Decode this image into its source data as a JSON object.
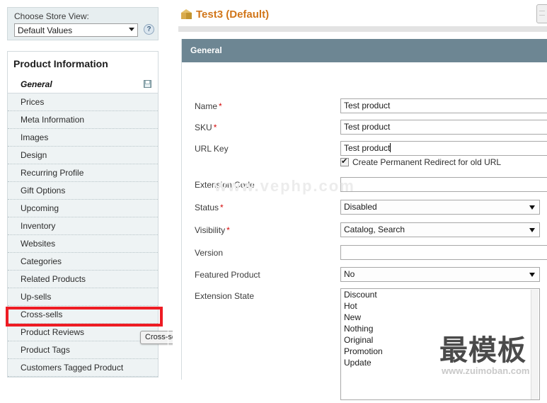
{
  "sidebar": {
    "store_view": {
      "label": "Choose Store View:",
      "selected": "Default Values",
      "help_glyph": "?"
    },
    "section_title": "Product Information",
    "general_tab": "General",
    "items": [
      {
        "label": "Prices"
      },
      {
        "label": "Meta Information"
      },
      {
        "label": "Images"
      },
      {
        "label": "Design"
      },
      {
        "label": "Recurring Profile"
      },
      {
        "label": "Gift Options"
      },
      {
        "label": "Upcoming"
      },
      {
        "label": "Inventory"
      },
      {
        "label": "Websites"
      },
      {
        "label": "Categories"
      },
      {
        "label": "Related Products"
      },
      {
        "label": "Up-sells"
      },
      {
        "label": "Cross-sells"
      },
      {
        "label": "Product Reviews"
      },
      {
        "label": "Product Tags"
      },
      {
        "label": "Customers Tagged Product"
      }
    ],
    "highlight": {
      "target": "Cross-sells",
      "color": "#ee1c24"
    },
    "tooltip": "Cross-sells"
  },
  "main": {
    "page_title": "Test3 (Default)",
    "title_color": "#d1761a",
    "fieldset_header": "General",
    "header_color": "#6d8693",
    "fields": [
      {
        "label": "Name",
        "required": true,
        "type": "text",
        "value": "Test product"
      },
      {
        "label": "SKU",
        "required": true,
        "type": "text",
        "value": "Test product"
      },
      {
        "label": "URL Key",
        "required": false,
        "type": "text",
        "value": "Test product"
      },
      {
        "label": "Extension Code",
        "required": false,
        "type": "text",
        "value": ""
      },
      {
        "label": "Status",
        "required": true,
        "type": "select",
        "value": "Disabled"
      },
      {
        "label": "Visibility",
        "required": true,
        "type": "select",
        "value": "Catalog, Search"
      },
      {
        "label": "Version",
        "required": false,
        "type": "text",
        "value": ""
      },
      {
        "label": "Featured Product",
        "required": false,
        "type": "select",
        "value": "No"
      },
      {
        "label": "Extension State",
        "required": false,
        "type": "multiselect",
        "value": ""
      }
    ],
    "url_key_checkbox": {
      "label": "Create Permanent Redirect for old URL",
      "checked": true
    },
    "extension_state_options": [
      "Discount",
      "Hot",
      "New",
      "Nothing",
      "Original",
      "Promotion",
      "Update"
    ]
  },
  "watermarks": {
    "center": "www.vephp.com",
    "cjk": "最模板",
    "url": "www.zuimoban.com"
  }
}
